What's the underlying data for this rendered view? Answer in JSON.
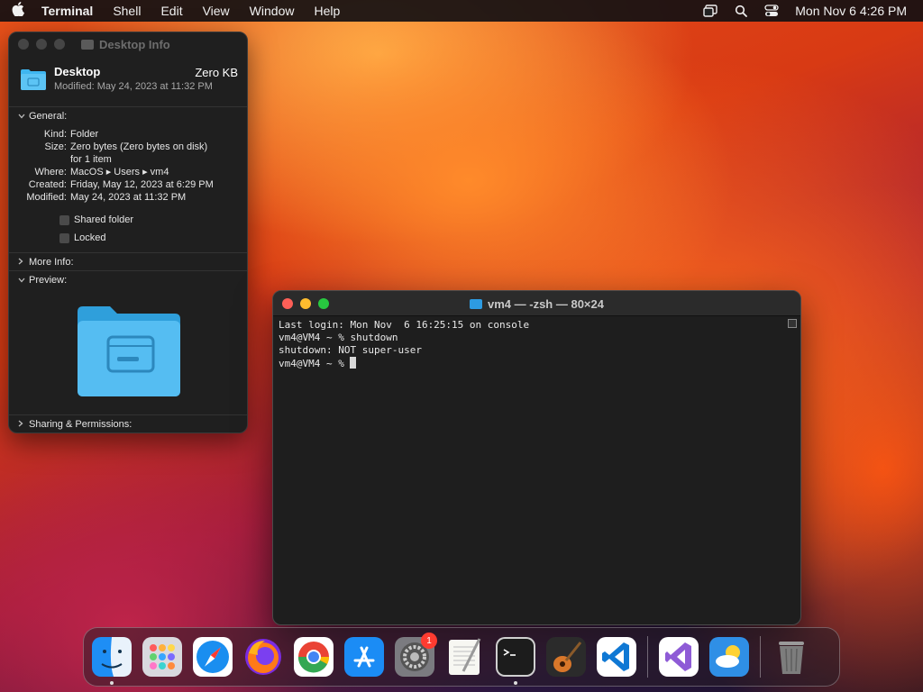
{
  "menubar": {
    "app_name": "Terminal",
    "menus": [
      "Shell",
      "Edit",
      "View",
      "Window",
      "Help"
    ],
    "clock": "Mon Nov 6  4:26 PM"
  },
  "info_window": {
    "title": "Desktop Info",
    "name": "Desktop",
    "size": "Zero KB",
    "modified_header": "Modified: May 24, 2023 at 11:32 PM",
    "general_label": "General:",
    "kind_label": "Kind:",
    "kind": "Folder",
    "size_label": "Size:",
    "size_value": "Zero bytes (Zero bytes on disk)",
    "size_value2": "for 1 item",
    "where_label": "Where:",
    "where": "MacOS ▸ Users ▸ vm4",
    "created_label": "Created:",
    "created": "Friday, May 12, 2023 at 6:29 PM",
    "modified_label": "Modified:",
    "modified": "May 24, 2023 at 11:32 PM",
    "shared_folder": "Shared folder",
    "locked": "Locked",
    "more_info": "More Info:",
    "preview": "Preview:",
    "sharing": "Sharing & Permissions:"
  },
  "terminal": {
    "title": "vm4 — -zsh — 80×24",
    "lines": [
      "Last login: Mon Nov  6 16:25:15 on console",
      "vm4@VM4 ~ % shutdown",
      "shutdown: NOT super-user",
      "vm4@VM4 ~ % "
    ]
  },
  "dock": {
    "items": [
      "finder",
      "launchpad",
      "safari",
      "firefox",
      "chrome",
      "app-store",
      "system-settings",
      "textedit",
      "terminal",
      "garageband",
      "vscode",
      "visual-studio",
      "weather",
      "trash"
    ],
    "settings_badge": "1"
  },
  "colors": {
    "terminal_bg": "#1e1e1e",
    "folder_blue": "#3fb6f0",
    "badge_red": "#ff3b30"
  }
}
